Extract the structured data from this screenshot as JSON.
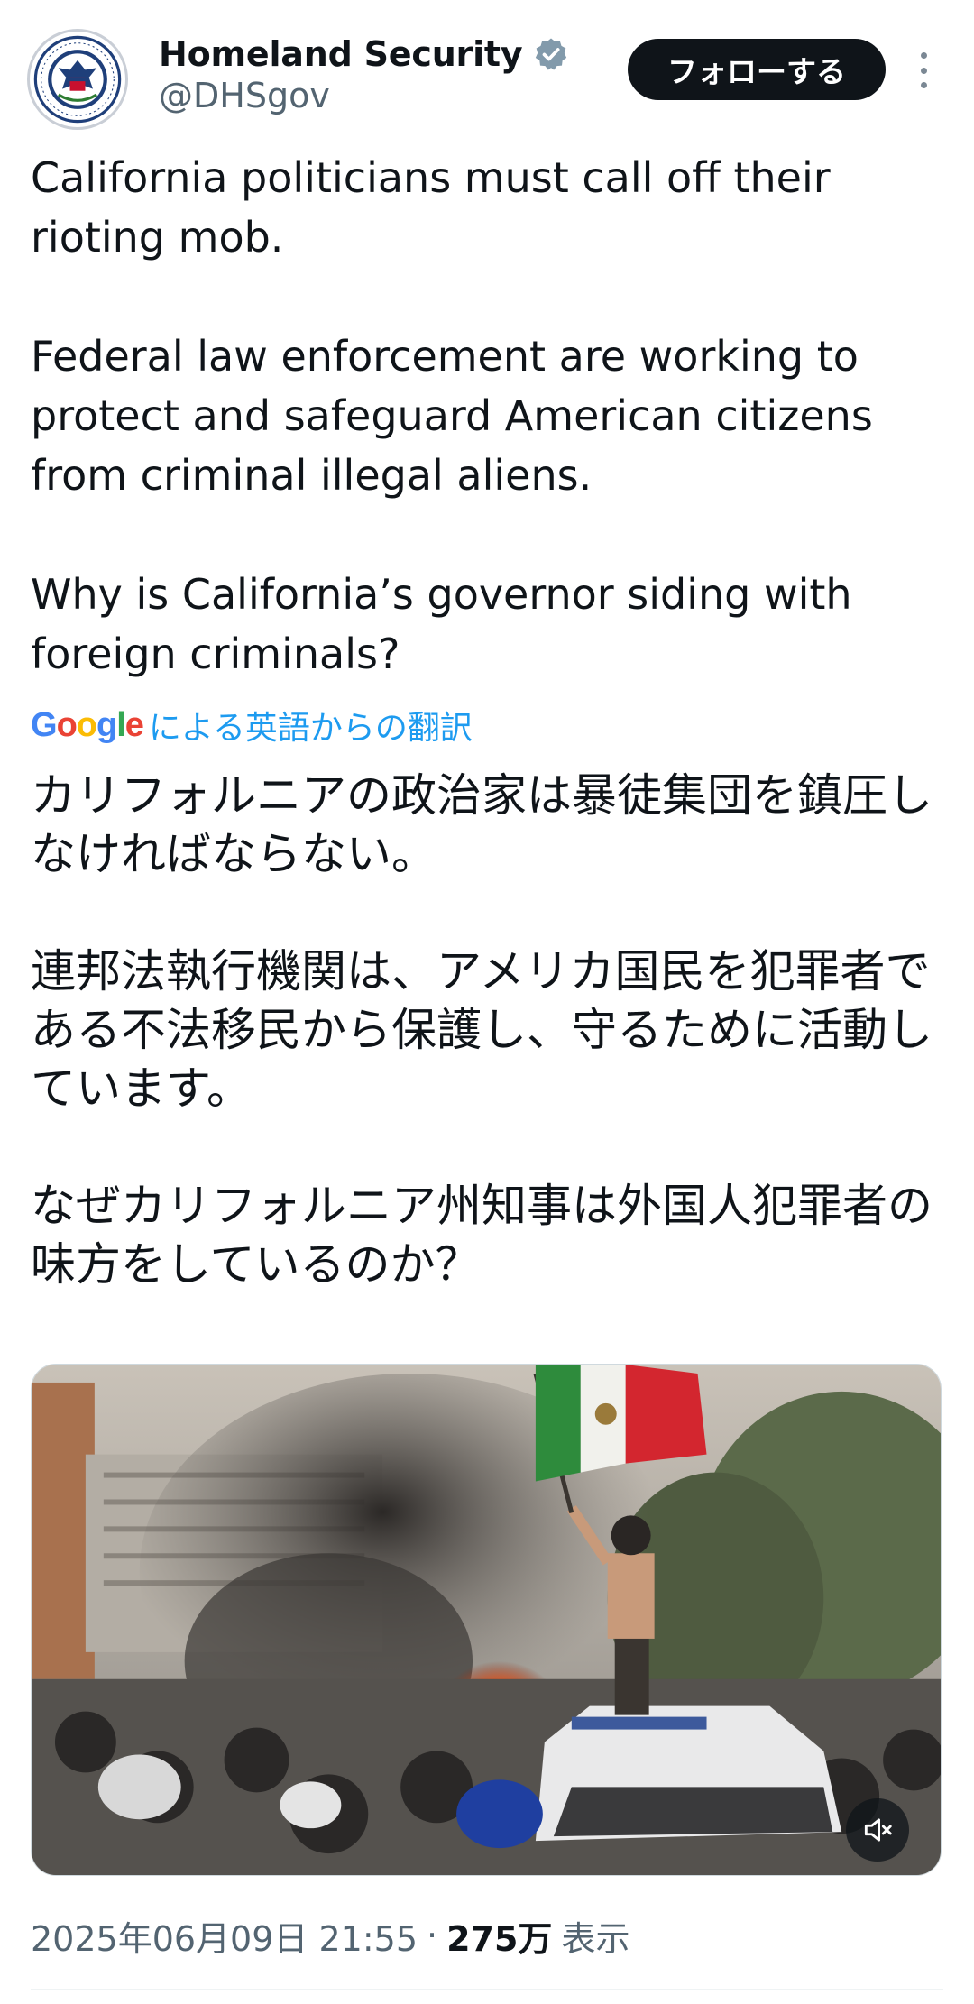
{
  "author": {
    "display_name": "Homeland Security",
    "handle": "@DHSgov",
    "verified_icon": "verified-badge-icon",
    "avatar_icon": "dhs-seal-icon"
  },
  "actions": {
    "follow_label": "フォローする",
    "more_icon": "more-options-icon"
  },
  "tweet": {
    "paragraphs": [
      "California politicians must call off their rioting mob.",
      "Federal law enforcement are working to protect and safeguard American citizens from criminal illegal aliens.",
      "Why is California’s governor siding with foreign criminals?"
    ]
  },
  "translation": {
    "provider": "Google",
    "label": "による英語からの翻訳",
    "paragraphs": [
      "カリフォルニアの政治家は暴徒集団を鎮圧しなければならない。",
      "連邦法執行機関は、アメリカ国民を犯罪者である不法移民から保護し、守るために活動しています。",
      "なぜカリフォルニア州知事は外国人犯罪者の味方をしているのか？"
    ]
  },
  "media": {
    "type": "video",
    "mute_icon": "speaker-muted-icon"
  },
  "meta": {
    "timestamp": "2025年06月09日 21:55",
    "separator": "·",
    "view_count": "275万",
    "views_label": "表示"
  },
  "colors": {
    "text": "#0f1419",
    "secondary": "#536471",
    "link": "#1d9bf0",
    "verified": "#829aab",
    "follow_bg": "#0f1419"
  }
}
